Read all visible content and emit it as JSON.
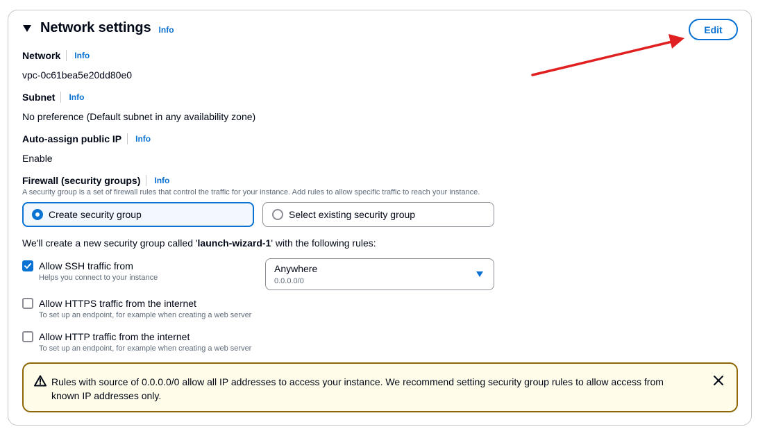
{
  "section": {
    "title": "Network settings",
    "info": "Info",
    "edit_label": "Edit"
  },
  "fields": {
    "network": {
      "label": "Network",
      "info": "Info",
      "value": "vpc-0c61bea5e20dd80e0"
    },
    "subnet": {
      "label": "Subnet",
      "info": "Info",
      "value": "No preference (Default subnet in any availability zone)"
    },
    "auto_ip": {
      "label": "Auto-assign public IP",
      "info": "Info",
      "value": "Enable"
    },
    "firewall": {
      "label": "Firewall (security groups)",
      "info": "Info",
      "description": "A security group is a set of firewall rules that control the traffic for your instance. Add rules to allow specific traffic to reach your instance."
    }
  },
  "firewall_options": {
    "create": {
      "label": "Create security group",
      "selected": true
    },
    "existing": {
      "label": "Select existing security group",
      "selected": false
    }
  },
  "intro": {
    "prefix": "We'll create a new security group called '",
    "name": "launch-wizard-1",
    "suffix": "' with the following rules:"
  },
  "rules": {
    "ssh": {
      "label": "Allow SSH traffic from",
      "description": "Helps you connect to your instance",
      "checked": true
    },
    "https": {
      "label": "Allow HTTPS traffic from the internet",
      "description": "To set up an endpoint, for example when creating a web server",
      "checked": false
    },
    "http": {
      "label": "Allow HTTP traffic from the internet",
      "description": "To set up an endpoint, for example when creating a web server",
      "checked": false
    }
  },
  "ssh_source": {
    "selected": "Anywhere",
    "sub": "0.0.0.0/0"
  },
  "alert": {
    "text": "Rules with source of 0.0.0.0/0 allow all IP addresses to access your instance. We recommend setting security group rules to allow access from known IP addresses only."
  },
  "icons": {
    "caret": "caret-down-icon",
    "warning": "warning-icon",
    "close": "close-icon",
    "check": "check-icon",
    "select_caret": "select-caret-icon"
  },
  "colors": {
    "accent": "#0972d3",
    "text": "#000716",
    "muted": "#5f6b7a",
    "warning_border": "#8d6605",
    "warning_bg": "#fffce9",
    "annotation_arrow": "#e02020"
  }
}
